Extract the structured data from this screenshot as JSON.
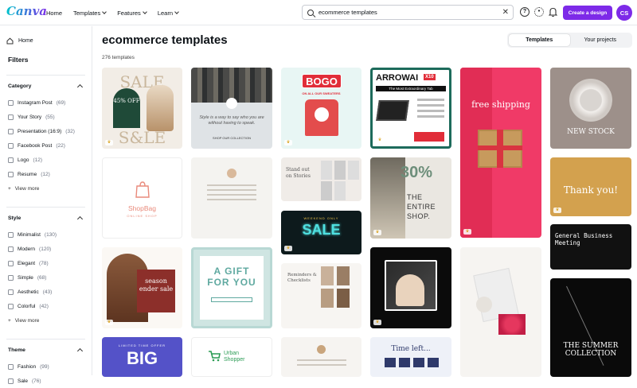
{
  "header": {
    "logo": "Canva",
    "nav": [
      "Home",
      "Templates",
      "Features",
      "Learn"
    ],
    "search_value": "ecommerce templates",
    "cta": "Create a design",
    "avatar": "CS"
  },
  "sidebar": {
    "home": "Home",
    "filters_title": "Filters",
    "category": {
      "title": "Category",
      "items": [
        {
          "label": "Instagram Post",
          "count": "(69)"
        },
        {
          "label": "Your Story",
          "count": "(55)"
        },
        {
          "label": "Presentation (16:9)",
          "count": "(32)"
        },
        {
          "label": "Facebook Post",
          "count": "(22)"
        },
        {
          "label": "Logo",
          "count": "(12)"
        },
        {
          "label": "Resume",
          "count": "(12)"
        }
      ],
      "more": "View more"
    },
    "style": {
      "title": "Style",
      "items": [
        {
          "label": "Minimalist",
          "count": "(130)"
        },
        {
          "label": "Modern",
          "count": "(120)"
        },
        {
          "label": "Elegant",
          "count": "(78)"
        },
        {
          "label": "Simple",
          "count": "(68)"
        },
        {
          "label": "Aesthetic",
          "count": "(43)"
        },
        {
          "label": "Colorful",
          "count": "(42)"
        }
      ],
      "more": "View more"
    },
    "theme": {
      "title": "Theme",
      "items": [
        {
          "label": "Fashion",
          "count": "(99)"
        },
        {
          "label": "Sale",
          "count": "(76)"
        }
      ]
    }
  },
  "main": {
    "title": "ecommerce templates",
    "count": "276 templates",
    "tabs": [
      "Templates",
      "Your projects"
    ]
  },
  "cards": {
    "sale_top": "SALE",
    "sale_pct": "45% OFF",
    "sale_bottom": "S&LE",
    "clothes_text": "Style is a way to say who you are without having to speak.",
    "clothes_shop": "SHOP OUR COLLECTION",
    "bogo": "BOGO",
    "bogo_sub": "ON ALL OUR SWEATERS",
    "arrowai": "ARROWAI",
    "arrowai_x": "X10",
    "arrowai_sub": "The Most Extraordinary Tab",
    "free_shipping": "free shipping",
    "new_stock": "NEW STOCK",
    "shopbag": "ShopBag",
    "shopbag_sub": "ONLINE SHOP",
    "stories": "Stand out on Stories",
    "thirty": "30%",
    "entire": "THE ENTIRE SHOP.",
    "thankyou": "Thank you!",
    "weekend_sale": "SALE",
    "weekend_top": "WEEKEND ONLY",
    "general": "General Business Meeting",
    "season": "season ender sale",
    "gift": "A GIFT FOR YOU",
    "reminders": "Reminders & Checklists",
    "summer": "THE SUMMER COLLECTION",
    "big": "BIG",
    "big_top": "LIMITED TIME OFFER",
    "urban": "Urban Shopper",
    "timeleft": "Time left..."
  },
  "colors": {
    "accent": "#7d2ae8",
    "teal": "#00c4cc",
    "bogo_red": "#e12d39",
    "pink": "#f03a67"
  }
}
